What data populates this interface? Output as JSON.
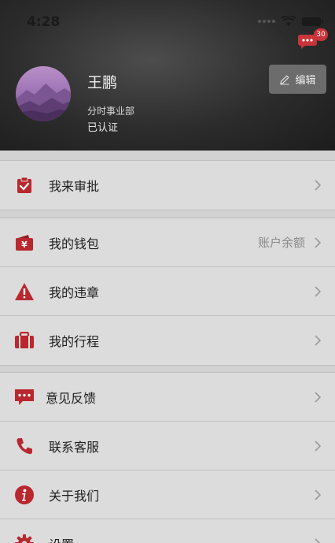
{
  "status_bar": {
    "time": "4:28"
  },
  "header": {
    "message_badge": "30",
    "user_name": "王鹏",
    "department": "分时事业部",
    "verified_status": "已认证",
    "edit_label": "编辑"
  },
  "menu": {
    "approval": {
      "label": "我来审批",
      "icon": "clipboard-check-icon"
    },
    "wallet": {
      "label": "我的钱包",
      "extra": "账户余额",
      "icon": "wallet-yen-icon"
    },
    "violations": {
      "label": "我的违章",
      "icon": "warning-triangle-icon"
    },
    "trips": {
      "label": "我的行程",
      "icon": "suitcase-icon"
    },
    "feedback": {
      "label": "意见反馈",
      "icon": "chat-bubble-icon"
    },
    "support": {
      "label": "联系客服",
      "icon": "phone-icon"
    },
    "about": {
      "label": "关于我们",
      "icon": "info-icon"
    },
    "settings": {
      "label": "设置",
      "icon": "gear-icon"
    }
  },
  "colors": {
    "accent": "#b8282e",
    "badge": "#c8343a"
  }
}
